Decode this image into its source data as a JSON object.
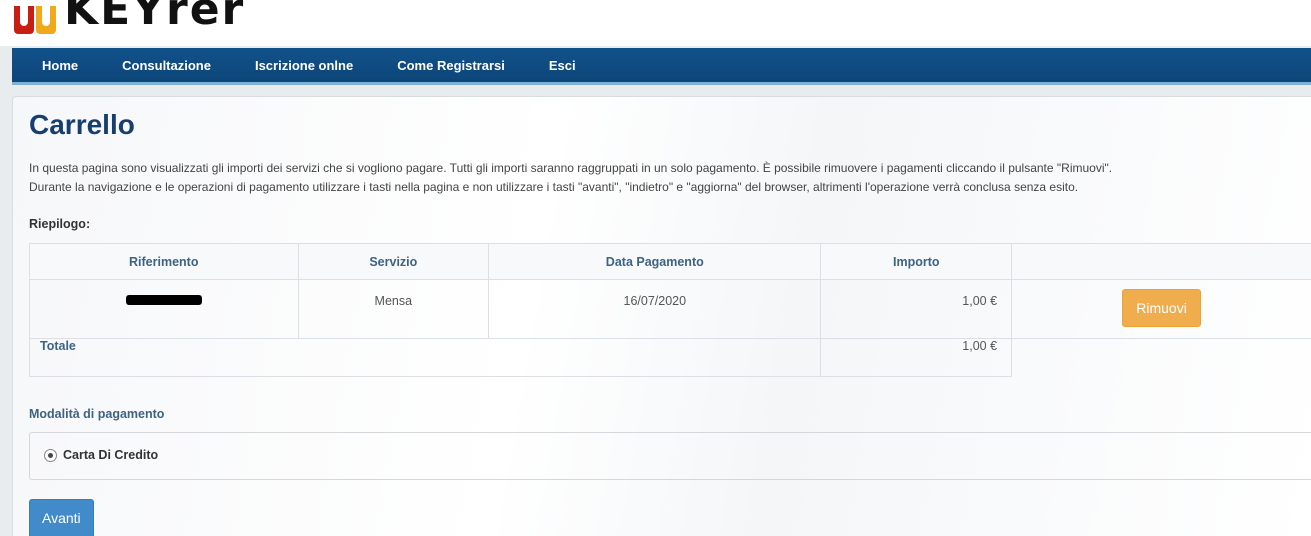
{
  "logo": {
    "text": "KEYrer"
  },
  "nav": {
    "items": [
      "Home",
      "Consultazione",
      "Iscrizione onlne",
      "Come Registrarsi",
      "Esci"
    ]
  },
  "page": {
    "title": "Carrello",
    "description_1": "In questa pagina sono visualizzati gli importi dei servizi che si vogliono pagare. Tutti gli importi saranno raggruppati in un solo pagamento. È possibile rimuovere i pagamenti cliccando il pulsante \"Rimuovi\".",
    "description_2": "Durante la navigazione e le operazioni di pagamento utilizzare i tasti nella pagina e non utilizzare i tasti \"avanti\", \"indietro\" e \"aggiorna\" del browser, altrimenti l'operazione verrà conclusa senza esito.",
    "summary_label": "Riepilogo:"
  },
  "table": {
    "headers": [
      "Riferimento",
      "Servizio",
      "Data Pagamento",
      "Importo",
      ""
    ],
    "rows": [
      {
        "servizio": "Mensa",
        "data": "16/07/2020",
        "importo": "1,00  €",
        "action": "Rimuovi"
      }
    ],
    "total_label": "Totale",
    "total_value": "1,00  €"
  },
  "payment": {
    "label": "Modalità di pagamento",
    "option": "Carta Di Credito"
  },
  "actions": {
    "next": "Avanti"
  }
}
